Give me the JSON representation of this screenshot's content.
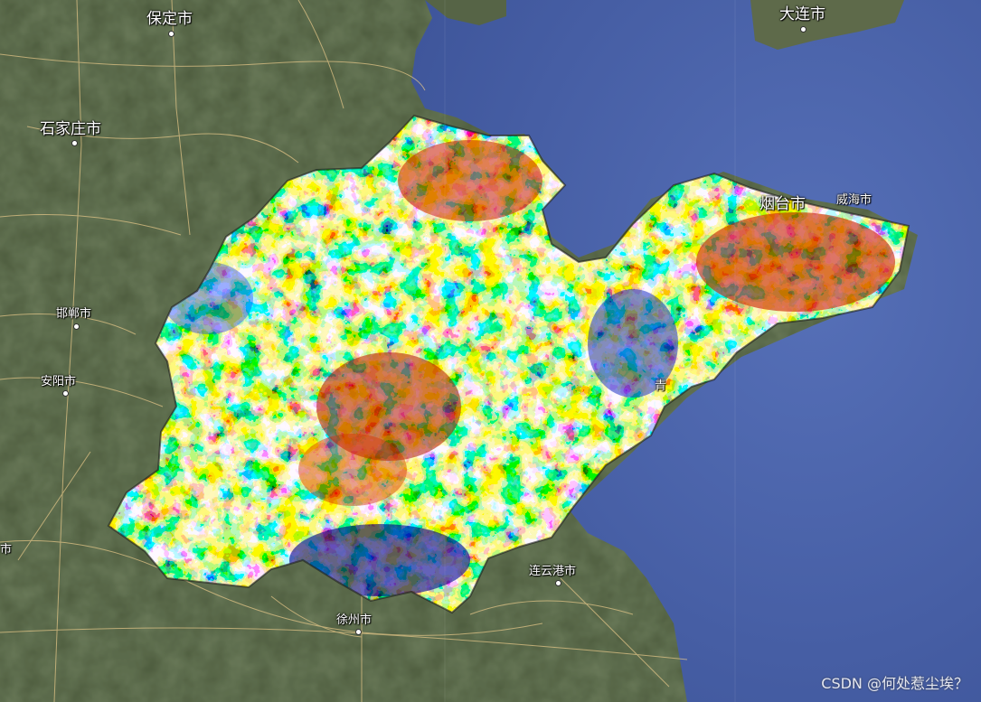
{
  "map": {
    "basemap": "satellite",
    "sea_color": "#4a63a8",
    "land_color": "#4a5a3a",
    "overlay_palette": [
      "#00008b",
      "#0a3cff",
      "#00c8ff",
      "#7cf07c",
      "#f5f032",
      "#ff8c00",
      "#d21e00",
      "#8b0000"
    ]
  },
  "cities": [
    {
      "id": "baoding",
      "label": "保定市"
    },
    {
      "id": "dalian",
      "label": "大连市"
    },
    {
      "id": "shijiazhuang",
      "label": "石家庄市"
    },
    {
      "id": "yantai",
      "label": "烟台市"
    },
    {
      "id": "weihai",
      "label": "威海市"
    },
    {
      "id": "handan",
      "label": "邯郸市"
    },
    {
      "id": "anyang",
      "label": "安阳市"
    },
    {
      "id": "lianyungang",
      "label": "连云港市"
    },
    {
      "id": "xuzhou",
      "label": "徐州市"
    },
    {
      "id": "edge_left",
      "label": "市"
    },
    {
      "id": "qingdao_partial",
      "label": "青"
    }
  ],
  "watermark": "CSDN @何处惹尘埃？"
}
